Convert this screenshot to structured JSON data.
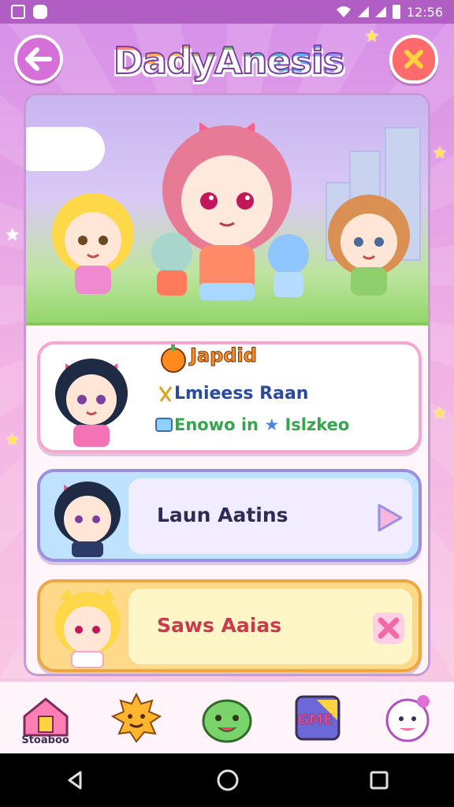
{
  "status_bar": {
    "time": "12:56",
    "icons": [
      "image-icon",
      "notification-icon",
      "wifi-icon",
      "signal-icon",
      "signal-icon",
      "battery-icon"
    ]
  },
  "header": {
    "title": "DadyAnesis",
    "back_icon": "back-arrow-icon",
    "close_icon": "close-icon"
  },
  "banner": {
    "scene": "chibi-group-illustration"
  },
  "cards": [
    {
      "heading": "Japdid",
      "line1": "Lmieess Raan",
      "line2": "Enowo in",
      "line2_suffix": "Islzkeo",
      "heading_icon": "orange-fruit-icon",
      "line1_icon": "ribbon-icon",
      "line2_icon": "book-icon"
    },
    {
      "title": "Laun Aatins",
      "action_icon": "play-arrow-icon"
    },
    {
      "title": "Saws Aaias",
      "action_icon": "close-x-icon"
    }
  ],
  "bottom_nav": {
    "items": [
      {
        "label": "Stoaboo",
        "icon": "house-icon"
      },
      {
        "label": "",
        "icon": "sun-face-icon"
      },
      {
        "label": "",
        "icon": "slime-face-icon"
      },
      {
        "label": "GME",
        "icon": "game-icon"
      },
      {
        "label": "",
        "icon": "ghost-face-icon"
      }
    ]
  },
  "colors": {
    "accent": "#d66fd8",
    "close": "#ff6b6b",
    "card1_border": "#f7a6cf",
    "card2_bg": "#bfe3ff",
    "card3_bg": "#ffd98a"
  }
}
